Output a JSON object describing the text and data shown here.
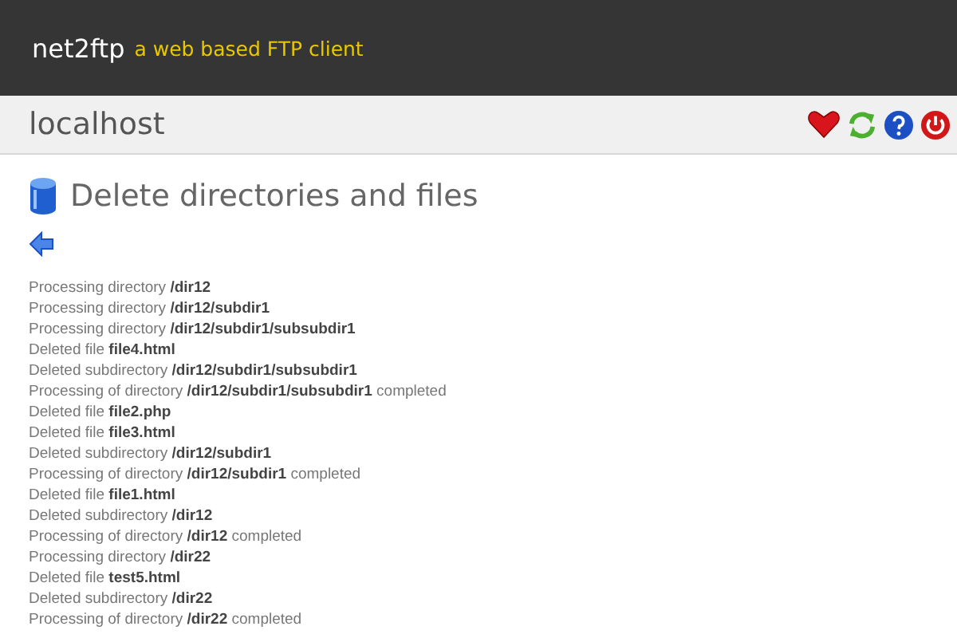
{
  "header": {
    "app_name": "net2ftp",
    "tagline": "a web based FTP client"
  },
  "server_bar": {
    "host": "localhost"
  },
  "page": {
    "title": "Delete directories and files"
  },
  "log": [
    "Processing directory **/dir12**",
    "Processing directory **/dir12/subdir1**",
    "Processing directory **/dir12/subdir1/subsubdir1**",
    "Deleted file **file4.html**",
    "Deleted subdirectory **/dir12/subdir1/subsubdir1**",
    "Processing of directory **/dir12/subdir1/subsubdir1** completed",
    "Deleted file **file2.php**",
    "Deleted file **file3.html**",
    "Deleted subdirectory **/dir12/subdir1**",
    "Processing of directory **/dir12/subdir1** completed",
    "Deleted file **file1.html**",
    "Deleted subdirectory **/dir12**",
    "Processing of directory **/dir12** completed",
    "Processing directory **/dir22**",
    "Deleted file **test5.html**",
    "Deleted subdirectory **/dir22**",
    "Processing of directory **/dir22** completed"
  ]
}
